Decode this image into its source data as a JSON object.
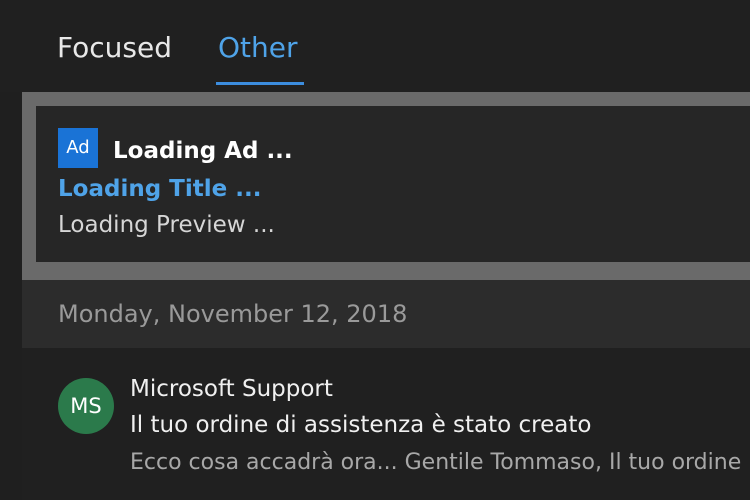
{
  "tabs": {
    "focused_label": "Focused",
    "other_label": "Other",
    "selected": "Other",
    "accent_color": "#3c8dde"
  },
  "ad": {
    "badge": "Ad",
    "sponsor": "Loading Ad ...",
    "title": "Loading Title ...",
    "preview": "Loading Preview ..."
  },
  "date_header": "Monday, November 12, 2018",
  "messages": [
    {
      "avatar_initials": "MS",
      "avatar_color": "#2b7a4b",
      "sender": "Microsoft Support",
      "subject": "Il tuo ordine di assistenza è stato creato",
      "preview": "Ecco cosa accadrà ora... Gentile Tommaso, Il tuo ordine"
    }
  ]
}
